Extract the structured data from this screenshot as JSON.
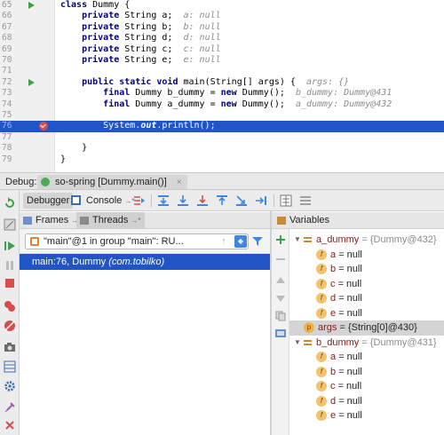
{
  "editor": {
    "lines": [
      {
        "n": "65",
        "parts": [
          [
            "kw",
            "class "
          ],
          [
            "plain",
            "Dummy {"
          ]
        ],
        "run": true
      },
      {
        "n": "66",
        "parts": [
          [
            "plain",
            "    "
          ],
          [
            "kw",
            "private "
          ],
          [
            "plain",
            "String a;  "
          ],
          [
            "hint",
            "a: null"
          ]
        ]
      },
      {
        "n": "67",
        "parts": [
          [
            "plain",
            "    "
          ],
          [
            "kw",
            "private "
          ],
          [
            "plain",
            "String b;  "
          ],
          [
            "hint",
            "b: null"
          ]
        ]
      },
      {
        "n": "68",
        "parts": [
          [
            "plain",
            "    "
          ],
          [
            "kw",
            "private "
          ],
          [
            "plain",
            "String d;  "
          ],
          [
            "hint",
            "d: null"
          ]
        ]
      },
      {
        "n": "69",
        "parts": [
          [
            "plain",
            "    "
          ],
          [
            "kw",
            "private "
          ],
          [
            "plain",
            "String c;  "
          ],
          [
            "hint",
            "c: null"
          ]
        ]
      },
      {
        "n": "70",
        "parts": [
          [
            "plain",
            "    "
          ],
          [
            "kw",
            "private "
          ],
          [
            "plain",
            "String e;  "
          ],
          [
            "hint",
            "e: null"
          ]
        ]
      },
      {
        "n": "71",
        "parts": []
      },
      {
        "n": "72",
        "parts": [
          [
            "plain",
            "    "
          ],
          [
            "kw",
            "public static void "
          ],
          [
            "plain",
            "main(String[] args) {  "
          ],
          [
            "hint",
            "args: {}"
          ]
        ],
        "run": true
      },
      {
        "n": "73",
        "parts": [
          [
            "plain",
            "        "
          ],
          [
            "kw",
            "final "
          ],
          [
            "plain",
            "Dummy b_dummy = "
          ],
          [
            "kw",
            "new "
          ],
          [
            "plain",
            "Dummy();  "
          ],
          [
            "hint",
            "b_dummy: Dummy@431"
          ]
        ]
      },
      {
        "n": "74",
        "parts": [
          [
            "plain",
            "        "
          ],
          [
            "kw",
            "final "
          ],
          [
            "plain",
            "Dummy a_dummy = "
          ],
          [
            "kw",
            "new "
          ],
          [
            "plain",
            "Dummy();  "
          ],
          [
            "hint",
            "a_dummy: Dummy@432"
          ]
        ]
      },
      {
        "n": "75",
        "parts": []
      },
      {
        "n": "76",
        "parts": [
          [
            "cur",
            "        System."
          ],
          [
            "cur-i",
            "out"
          ],
          [
            "cur",
            ".println();"
          ]
        ],
        "current": true,
        "breakpoint": true
      },
      {
        "n": "77",
        "parts": []
      },
      {
        "n": "78",
        "parts": [
          [
            "plain",
            "    }"
          ]
        ]
      },
      {
        "n": "79",
        "parts": [
          [
            "plain",
            "}"
          ]
        ]
      }
    ]
  },
  "debug": {
    "label": "Debug:",
    "session_tab": "so-spring [Dummy.main()]",
    "close_glyph": "×"
  },
  "toolbar": {
    "debugger_tab": "Debugger",
    "console_tab": "Console",
    "console_suffix": "→*"
  },
  "frames": {
    "frames_tab": "Frames",
    "threads_tab": "Threads",
    "tab_suffix": "→*",
    "thread_selector": "\"main\"@1 in group \"main\": RU...",
    "selected_frame_loc": "main:76, Dummy",
    "selected_frame_pkg": "(com.tobilko)"
  },
  "variables": {
    "title": "Variables",
    "rows": [
      {
        "kind": "obj",
        "expanded": true,
        "name": "a_dummy",
        "value": "= {Dummy@432}",
        "gray": true
      },
      {
        "kind": "field",
        "name": "a",
        "value": "= null"
      },
      {
        "kind": "field",
        "name": "b",
        "value": "= null"
      },
      {
        "kind": "field",
        "name": "c",
        "value": "= null"
      },
      {
        "kind": "field",
        "name": "d",
        "value": "= null"
      },
      {
        "kind": "field",
        "name": "e",
        "value": "= null"
      },
      {
        "kind": "param",
        "name": "args",
        "value": "= {String[0]@430}",
        "selected": true
      },
      {
        "kind": "obj",
        "expanded": true,
        "name": "b_dummy",
        "value": "= {Dummy@431}",
        "gray": true
      },
      {
        "kind": "field",
        "name": "a",
        "value": "= null"
      },
      {
        "kind": "field",
        "name": "b",
        "value": "= null"
      },
      {
        "kind": "field",
        "name": "c",
        "value": "= null"
      },
      {
        "kind": "field",
        "name": "d",
        "value": "= null"
      },
      {
        "kind": "field",
        "name": "e",
        "value": "= null"
      }
    ]
  },
  "colors": {
    "selection": "#2154c4",
    "keyword": "#000080",
    "var_name": "#8a1818",
    "run_green": "#3aa24a",
    "breakpoint_red": "#d64d4d"
  }
}
